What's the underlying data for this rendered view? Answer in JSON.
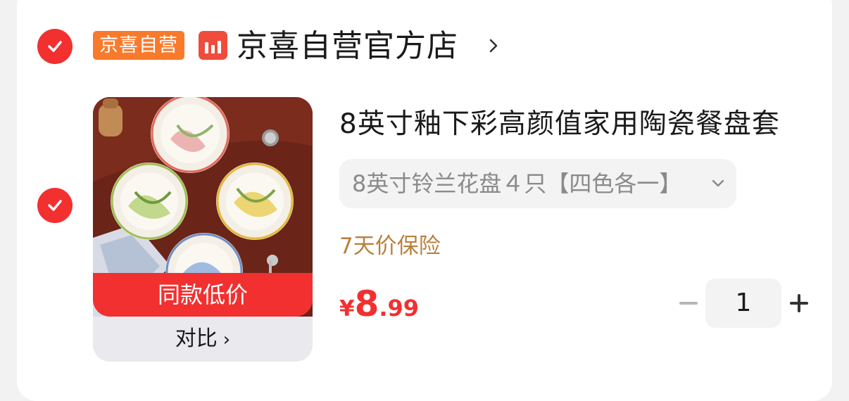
{
  "shop": {
    "badge": "京喜自营",
    "name": "京喜自营官方店"
  },
  "product": {
    "title": "8英寸釉下彩高颜值家用陶瓷餐盘套",
    "spec": "8英寸铃兰花盘４只【四色各一】",
    "insurance": "7天价保险",
    "price": {
      "currency": "¥",
      "integer": "8",
      "decimal": ".99"
    },
    "quantity": "1",
    "image_banner": "同款低价",
    "compare_label": "对比"
  },
  "colors": {
    "accent_red": "#f23030",
    "badge_orange": "#f97a2b",
    "insurance_gold": "#b8813e"
  }
}
